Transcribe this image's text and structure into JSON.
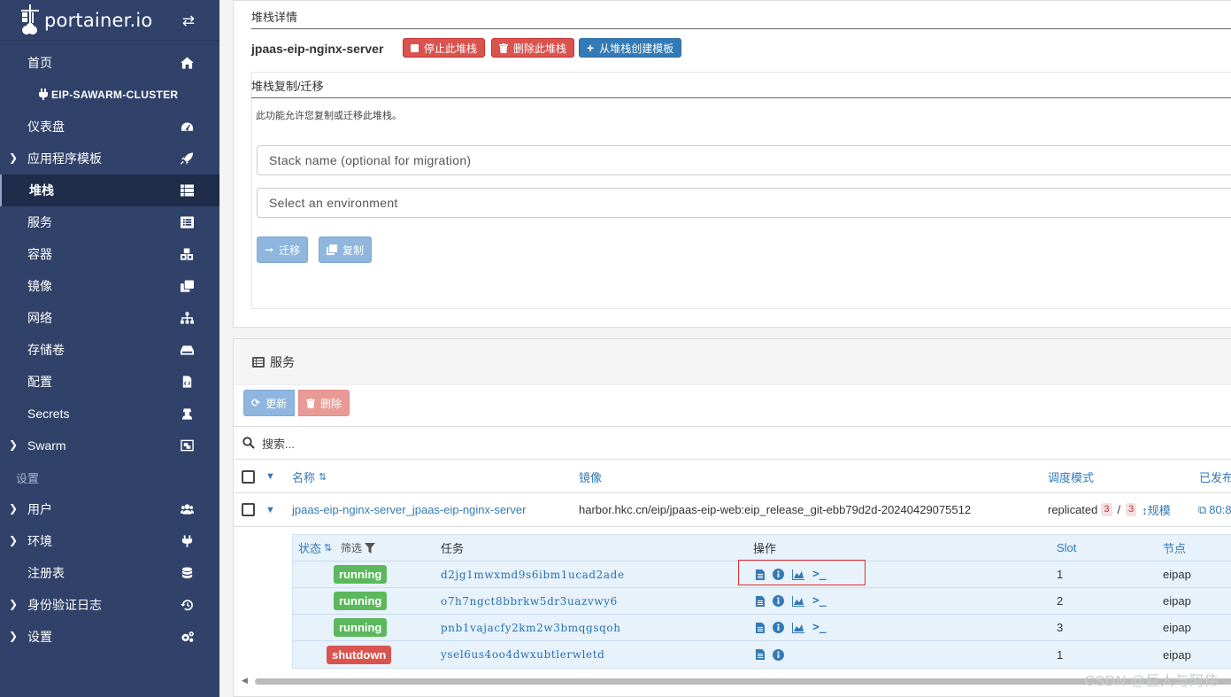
{
  "brand": {
    "logo_text": "portainer.io"
  },
  "sidebar": {
    "home": "首页",
    "cluster": "EIP-SAWARM-CLUSTER",
    "items": [
      {
        "label": "仪表盘",
        "icon": "dashboard-icon"
      },
      {
        "label": "应用程序模板",
        "icon": "rocket-icon",
        "expandable": true
      },
      {
        "label": "堆栈",
        "icon": "th-large-icon",
        "active": true
      },
      {
        "label": "服务",
        "icon": "list-alt-icon"
      },
      {
        "label": "容器",
        "icon": "cubes-icon"
      },
      {
        "label": "镜像",
        "icon": "clone-icon"
      },
      {
        "label": "网络",
        "icon": "sitemap-icon"
      },
      {
        "label": "存储卷",
        "icon": "hdd-icon"
      },
      {
        "label": "配置",
        "icon": "file-code-icon"
      },
      {
        "label": "Secrets",
        "icon": "user-secret-icon"
      },
      {
        "label": "Swarm",
        "icon": "object-group-icon",
        "expandable": true
      }
    ],
    "settings_section": "设置",
    "settings_items": [
      {
        "label": "用户",
        "icon": "users-icon",
        "expandable": true
      },
      {
        "label": "环境",
        "icon": "plug-icon",
        "expandable": true
      },
      {
        "label": "注册表",
        "icon": "database-icon"
      },
      {
        "label": "身份验证日志",
        "icon": "history-icon",
        "expandable": true
      },
      {
        "label": "设置",
        "icon": "cogs-icon",
        "expandable": true
      }
    ]
  },
  "stack_details": {
    "heading": "堆栈详情",
    "name": "jpaas-eip-nginx-server",
    "stop_label": "停止此堆栈",
    "delete_label": "删除此堆栈",
    "template_label": "从堆栈创建模板"
  },
  "migration": {
    "heading": "堆栈复制/迁移",
    "help": "此功能允许您复制或迁移此堆栈。",
    "name_placeholder": "Stack name (optional for migration)",
    "env_placeholder": "Select an environment",
    "migrate_label": "迁移",
    "copy_label": "复制"
  },
  "services": {
    "title": "服务",
    "refresh_label": "更新",
    "delete_label": "删除",
    "search_placeholder": "搜索...",
    "columns": {
      "name": "名称",
      "image": "镜像",
      "mode": "调度模式",
      "published": "已发布"
    },
    "row": {
      "name": "jpaas-eip-nginx-server_jpaas-eip-nginx-server",
      "image": "harbor.hkc.cn/eip/jpaas-eip-web:eip_release_git-ebb79d2d-20240429075512",
      "mode": "replicated",
      "running": "3",
      "sep": "/",
      "desired": "3",
      "scale_label": "规模",
      "published": "80:8"
    },
    "tasks_columns": {
      "status": "状态",
      "filter": "筛选",
      "task": "任务",
      "actions": "操作",
      "slot": "Slot",
      "node": "节点"
    },
    "tasks": [
      {
        "status": "running",
        "id": "d2jg1mwxmd9s6ibm1ucad2ade",
        "slot": "1",
        "node": "eipap"
      },
      {
        "status": "running",
        "id": "o7h7ngct8bbrkw5dr3uazvwy6",
        "slot": "2",
        "node": "eipap"
      },
      {
        "status": "running",
        "id": "pnb1vajacfy2km2w3bmqgsqoh",
        "slot": "3",
        "node": "eipap"
      },
      {
        "status": "shutdown",
        "id": "ysel6us4oo4dwxubtlerwletd",
        "slot": "1",
        "node": "eipap"
      }
    ]
  },
  "watermark": "CSDN @巨人与阿伟",
  "colors": {
    "sidebar": "#30426a",
    "active": "#1f2d4a",
    "link": "#337ab7",
    "running": "#5cb85c",
    "shutdown": "#d9534f"
  }
}
